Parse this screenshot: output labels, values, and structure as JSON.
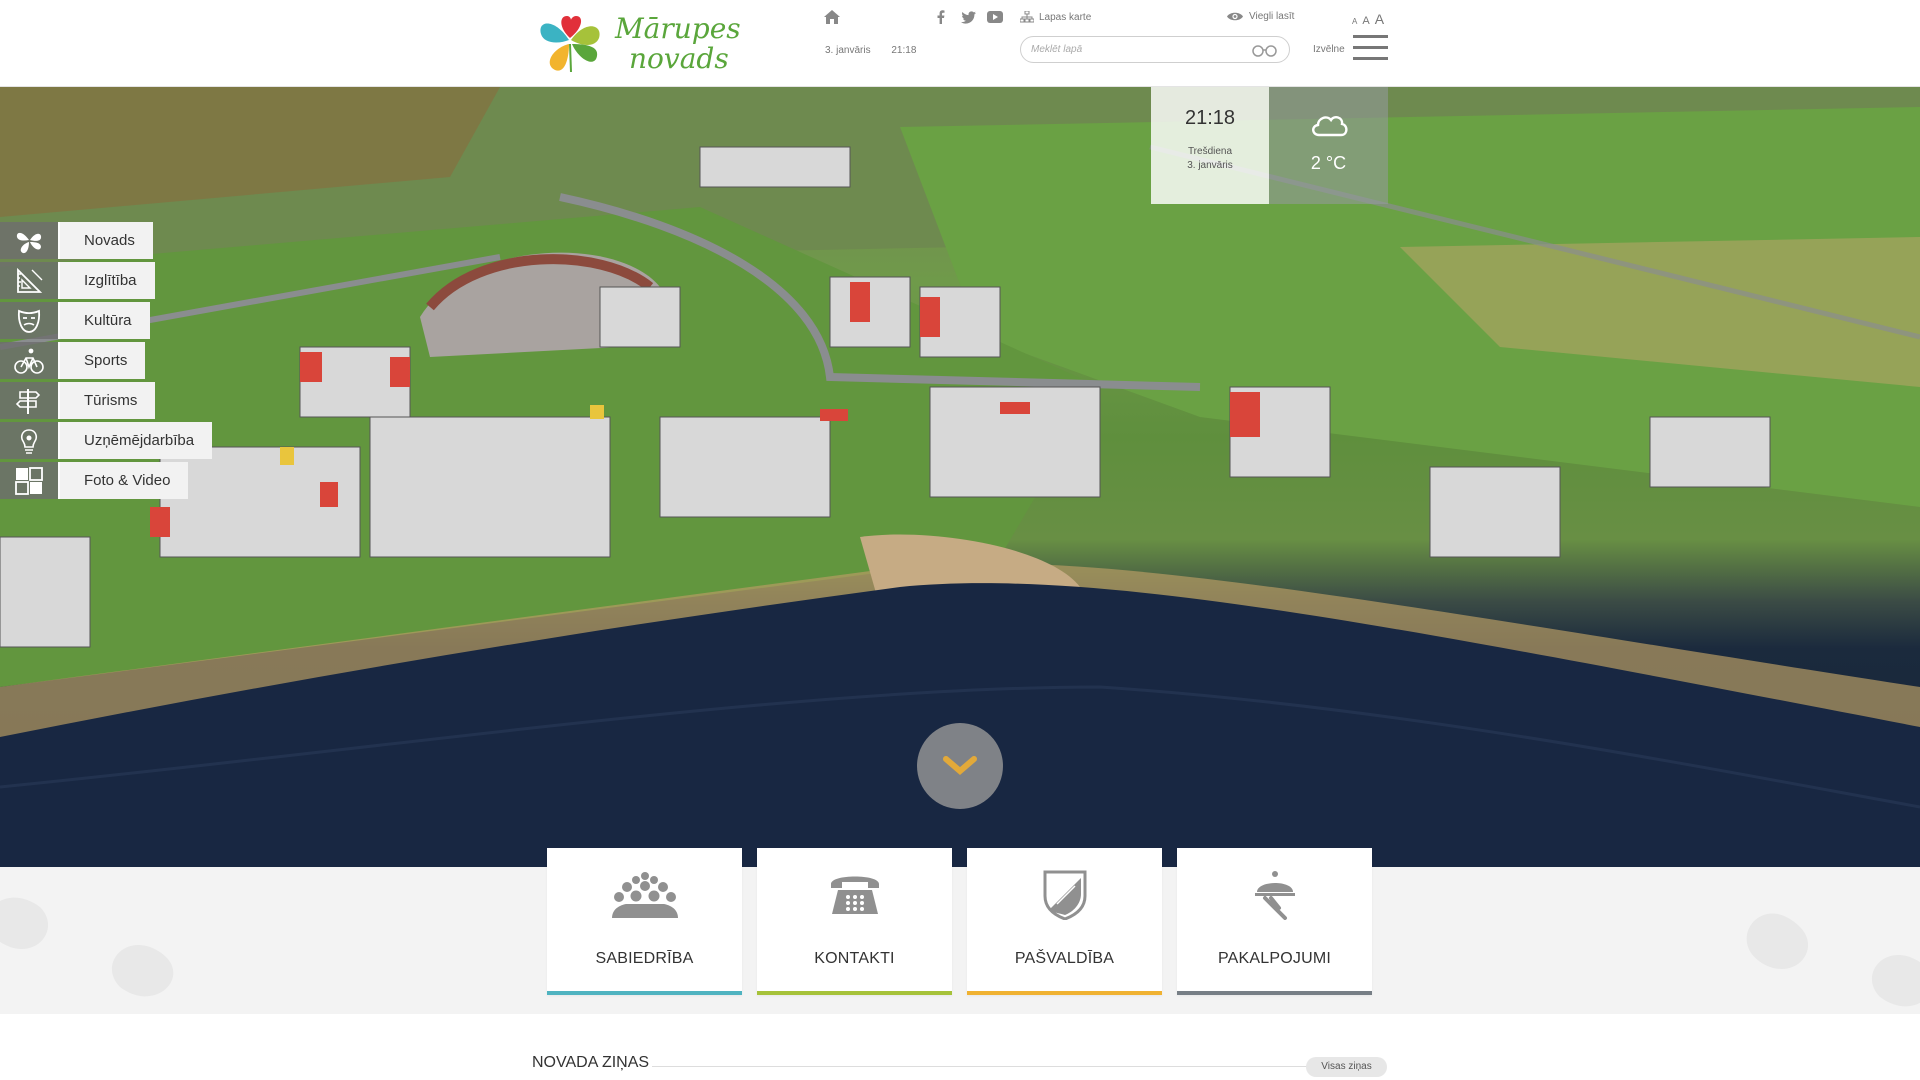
{
  "header": {
    "logo_text_line1": "Mārupes",
    "logo_text_line2": "novads",
    "date": "3. janvāris",
    "time": "21:18",
    "sitemap_label": "Lapas karte",
    "easyread_label": "Viegli lasīt",
    "font_small": "A",
    "font_medium": "A",
    "font_large": "A",
    "search_placeholder": "Meklēt lapā",
    "menu_label": "Izvēlne",
    "social_icons": [
      "facebook-icon",
      "twitter-icon",
      "youtube-icon"
    ]
  },
  "widget": {
    "time": "21:18",
    "weekday": "Trešdiena",
    "date": "3. janvāris",
    "temperature": "2 °C",
    "weather_icon": "cloud-icon"
  },
  "side_menu": [
    {
      "label": "Novads",
      "icon": "clover-icon"
    },
    {
      "label": "Izglītība",
      "icon": "ruler-icon"
    },
    {
      "label": "Kultūra",
      "icon": "theatre-mask-icon"
    },
    {
      "label": "Sports",
      "icon": "bicycle-icon"
    },
    {
      "label": "Tūrisms",
      "icon": "signpost-icon"
    },
    {
      "label": "Uzņēmējdarbība",
      "icon": "lightbulb-icon"
    },
    {
      "label": "Foto & Video",
      "icon": "gallery-icon"
    }
  ],
  "quick_links": [
    {
      "label": "SABIEDRĪBA",
      "icon": "crowd-icon",
      "color": "#4fb3c0"
    },
    {
      "label": "KONTAKTI",
      "icon": "telephone-icon",
      "color": "#a6c23a"
    },
    {
      "label": "PAŠVALDĪBA",
      "icon": "coat-of-arms-icon",
      "color": "#f0b232"
    },
    {
      "label": "PAKALPOJUMI",
      "icon": "service-bell-icon",
      "color": "#777f86"
    }
  ],
  "news": {
    "title": "NOVADA ZIŅAS",
    "all_label": "Visas ziņas"
  },
  "colors": {
    "icon_gray": "#8e8e8e",
    "scroll_arrow": "#e2a93a"
  }
}
